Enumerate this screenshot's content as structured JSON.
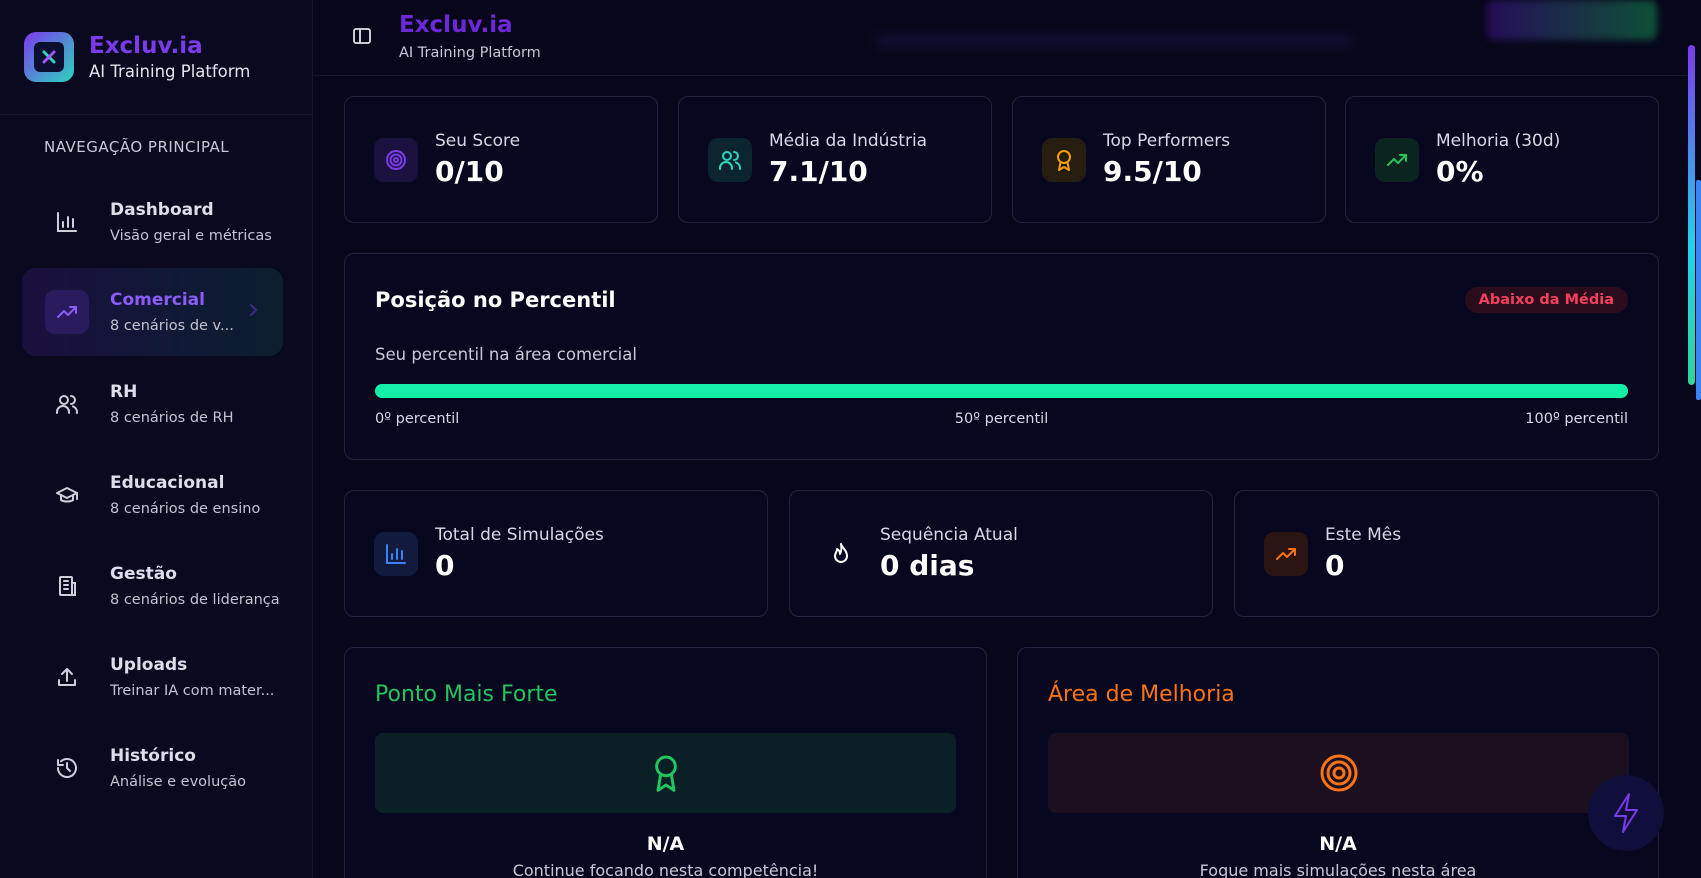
{
  "brand": {
    "name": "Excluv.ia",
    "subtitle": "AI Training Platform"
  },
  "nav": {
    "section_title": "NAVEGAÇÃO PRINCIPAL",
    "items": [
      {
        "label": "Dashboard",
        "sub": "Visão geral e métricas",
        "icon": "bar-chart-icon",
        "active": false
      },
      {
        "label": "Comercial",
        "sub": "8 cenários de v...",
        "icon": "trending-up-icon",
        "active": true
      },
      {
        "label": "RH",
        "sub": "8 cenários de RH",
        "icon": "users-icon",
        "active": false
      },
      {
        "label": "Educacional",
        "sub": "8 cenários de ensino",
        "icon": "graduation-cap-icon",
        "active": false
      },
      {
        "label": "Gestão",
        "sub": "8 cenários de liderança",
        "icon": "building-icon",
        "active": false
      },
      {
        "label": "Uploads",
        "sub": "Treinar IA com mater...",
        "icon": "upload-icon",
        "active": false
      },
      {
        "label": "Histórico",
        "sub": "Análise e evolução",
        "icon": "history-icon",
        "active": false
      }
    ]
  },
  "header": {
    "title": "Excluv.ia",
    "subtitle": "AI Training Platform"
  },
  "stats": [
    {
      "label": "Seu Score",
      "value": "0/10",
      "icon": "target-icon",
      "color": "#7c3aed"
    },
    {
      "label": "Média da Indústria",
      "value": "7.1/10",
      "icon": "users-icon",
      "color": "#2dd4bf"
    },
    {
      "label": "Top Performers",
      "value": "9.5/10",
      "icon": "award-icon",
      "color": "#f59e0b"
    },
    {
      "label": "Melhoria (30d)",
      "value": "0%",
      "icon": "trending-up-icon",
      "color": "#22c55e"
    }
  ],
  "percentile": {
    "title": "Posição no Percentil",
    "badge": "Abaixo da Média",
    "subtitle": "Seu percentil na área comercial",
    "ticks": [
      "0º percentil",
      "50º percentil",
      "100º percentil"
    ],
    "fill_percent": 100
  },
  "activity": [
    {
      "label": "Total de Simulações",
      "value": "0",
      "icon": "bar-chart-icon",
      "color": "#3b82f6"
    },
    {
      "label": "Sequência Atual",
      "value": "0 dias",
      "icon": "flame-icon",
      "color": "#ffffff"
    },
    {
      "label": "Este Mês",
      "value": "0",
      "icon": "trending-up-icon",
      "color": "#f97316"
    }
  ],
  "strongest": {
    "title": "Ponto Mais Forte",
    "value": "N/A",
    "message": "Continue focando nesta competência!",
    "color": "#22c55e"
  },
  "improvement": {
    "title": "Área de Melhoria",
    "value": "N/A",
    "message": "Foque mais simulações nesta área",
    "color": "#f97316"
  }
}
